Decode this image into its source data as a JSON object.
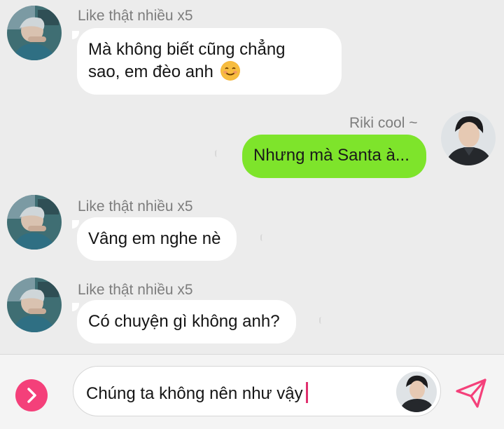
{
  "messages": [
    {
      "direction": "incoming",
      "sender": "Like thật nhiều x5",
      "text_line1": "Mà không biết cũng chẳng",
      "text_line2": "sao, em đèo anh",
      "emoji": "☺"
    },
    {
      "direction": "outgoing",
      "sender": "Riki cool ~",
      "text": "Nhưng mà Santa à..."
    },
    {
      "direction": "incoming",
      "sender": "Like thật nhiều x5",
      "text": "Vâng em nghe nè"
    },
    {
      "direction": "incoming",
      "sender": "Like thật nhiều x5",
      "text": "Có chuyện gì không anh?"
    }
  ],
  "composer": {
    "input_value": "Chúng ta không nên như vậy",
    "plus_icon": "chevron-right-icon",
    "send_icon": "send-icon"
  },
  "colors": {
    "background": "#ececec",
    "incoming_bubble": "#ffffff",
    "outgoing_bubble": "#7ee42b",
    "accent_pink": "#f4407a"
  }
}
